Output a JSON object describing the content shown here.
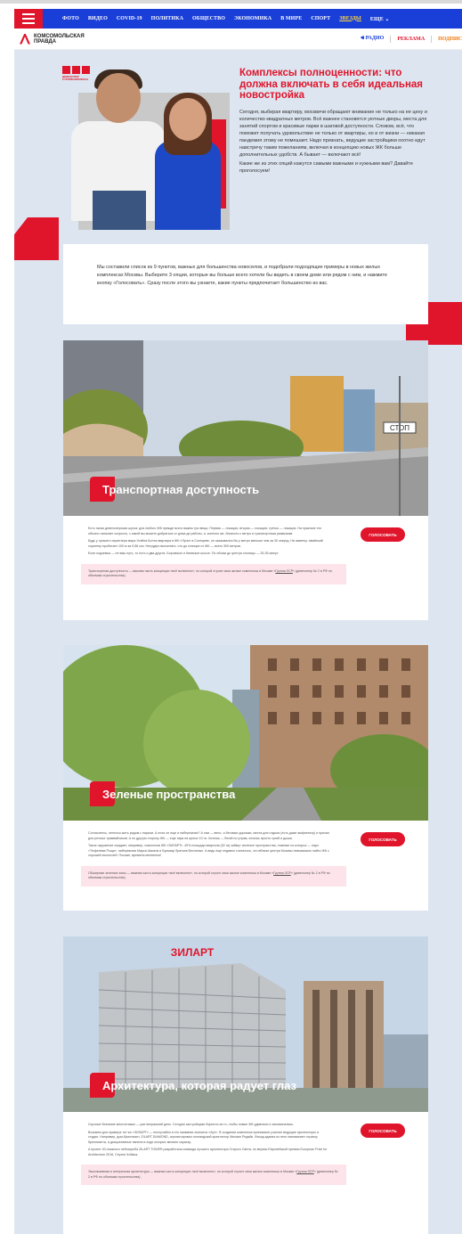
{
  "nav": {
    "items": [
      "ФОТО",
      "ВИДЕО",
      "COVID-19",
      "ПОЛИТИКА",
      "ОБЩЕСТВО",
      "ЭКОНОМИКА",
      "В МИРЕ",
      "СПОРТ",
      "ЗВЕЗДЫ",
      "ЕЩЕ ⌄"
    ],
    "highlighted_index": 8
  },
  "brand": {
    "logo_line1": "Комсомольская",
    "logo_line2": "правда",
    "radio": "РАДИО",
    "ads": "РЕКЛАМА",
    "subscribe": "ПОДПИС"
  },
  "developer": {
    "line1": "ДЕВЕЛОПЕР",
    "line2": "СТРОЙКОМПЛЕКСА"
  },
  "hero": {
    "title": "Комплексы полноценности: что должна включать в себя идеальная новостройка",
    "paragraph": "Сегодня, выбирая квартиру, москвичи обращают внимание не только на ее цену и количество квадратных метров. Всё важнее становятся уютные дворы, места для занятий спортом и красивые парки в шаговой доступности. Словом, всё, что поможет получать удовольствие не только от квартиры, но и от жизни — никакая пандемия этому не помешает. Надо признать, ведущие застройщики охотно идут навстречу таким пожеланиям, включая в концепцию новых ЖК больше дополнительных удобств. А бывает — включают всё!",
    "question": "Какие же из этих опций кажутся самыми важными и нужными вам? Давайте проголосуем!"
  },
  "intro": "Мы составили список из 9 пунктов, важных для большинства новоселов, и подобрали подходящие примеры в новых жилых комплексах Москвы. Выберите 3 опции, которые вы больше всего хотели бы видеть в своем доме или рядом с ним, и нажмите кнопку «Голосовать». Сразу после этого вы узнаете, какие пункты предпочитает большинство из вас.",
  "cards": [
    {
      "label": "Транспортная доступность",
      "paragraphs": [
        "Есть такая девелоперская шутка: для любого ЖК прежде всего важны три вещи. Первая — локация, вторая — локация, третья — локация. На практике это обычно означает скорость, с какой вы можете добраться от дома до работы, и, конечно же, близость к метро и транспортным развязкам.",
        "Будь у лучшего спринтера мира Усэйна Болта квартира в ЖК «Лучи» в Солнцеве, он оказывался бы у метро меньше чем за 30 секунд. На заметку: ямайский спринтер пробегает 100 м за 9,58 сек. Нетрудно высчитать, что до станции от ЖК — всего 300 метров.",
        "Если подземка — не ваш путь, то есть и два других. Боровское и Киевское шоссе. По обоим до центра столицы — 25-35 минут."
      ],
      "note_before": "Транспортная доступность — важная часть концепции «всё включено», по которой строит свои жилые комплексы в Москве «",
      "note_link": "Группа ЛСР",
      "note_after": "» (девелопер № 2 в РФ по объемам строительства)."
    },
    {
      "label": "Зеленые пространства",
      "paragraphs": [
        "Согласитесь, неплохо жить рядом с парком. А если он еще и набережная? А там — вело- и беговые дорожки, места для отдыха (есть даже амфитеатр) и причал для речных трамвайчиков. А по другую сторону ЖК — еще парк на целых 10 га. Хочешь — бегай по утрам, хочешь просто гуляй и дыши.",
        "Такое окружение ожидает, например, новоселов ЖК «ЗИЛАРТ». 40% площади квартала (52 га) займут зеленые пространства, главные из которых — парк «Тюфелева Роща», набережная Марка Шагала и Бульвар братьев Весниных. А ведь еще недавно считалось, что вблизи центра Москвы невозможно найти ЖК с хорошей экологией. Похоже, времена меняются!"
      ],
      "note_before": "Обширные зеленые зоны — важная часть концепции «всё включено», по которой строит свои жилые комплексы в Москве «",
      "note_link": "Группа ЛСР",
      "note_after": "» (девелопер № 2 в РФ по объемам строительства)."
    },
    {
      "label": "Архитектура, которая радует глаз",
      "paragraphs": [
        "Скучные безликие многоэтажки — уже вчерашний день. Сегодня застройщики борются за то, чтобы новые ЖК удивляли и запоминались.",
        "Возьмем для примера тот же «ЗИЛАРТ» — неслучайно в его названии значится «Арт». В создании комплекса принимали участие ведущие архитекторы и студии. Например, дом-бриллиант, ZILART DIAMOND, спроектировал голландский архитектор Михаил Ридайк. Фасад здания из него напоминает огранку бриллианта, а декоративные панели в ходе которых меняют окраску.",
        "А проект 40-этажного небоскреба ZILART TOWER разработала команда лучшего архитектора Старого Света, по версии Европейской премии European Prize for Architecture 2016, Сергея Чобана."
      ],
      "note_before": "Эксклюзивная и интересная архитектура — важная часть концепции «всё включено», по которой строит свои жилые комплексы в Москве «",
      "note_link": "Группа ЛСР",
      "note_after": "» (девелопер № 2 в РФ по объемам строительства)."
    }
  ],
  "vote_label": "ГОЛОСОВАТЬ",
  "road_sign": "СТОП",
  "building_sign": "ЗИЛАРТ",
  "colors": {
    "accent": "#e0142b",
    "nav": "#1a3fd8",
    "background": "#dde6f0",
    "note": "#fde4ea"
  },
  "icons": {
    "menu": "hamburger-icon",
    "radio": "speaker-icon",
    "logo": "kp-logo-icon"
  }
}
